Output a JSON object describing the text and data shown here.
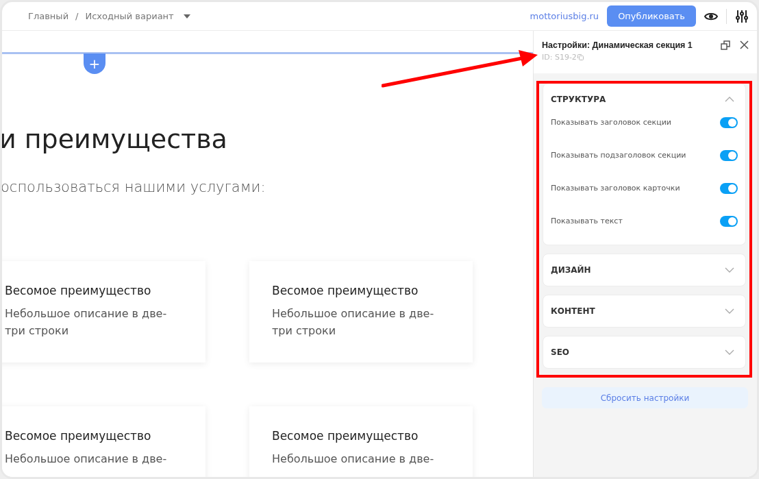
{
  "topbar": {
    "breadcrumbs": [
      {
        "label": "Главный"
      },
      {
        "label": "/"
      },
      {
        "label": "Исходный вариант"
      }
    ],
    "site_link": "mottoriusbig.ru",
    "publish_button": "Опубликовать"
  },
  "canvas": {
    "add_button": "+",
    "heading": "и преимущества",
    "subheading": "оспользоваться нашими услугами:",
    "cards": [
      {
        "title": "Весомое преимущество",
        "description": "Небольшое описание в две-\nтри строки"
      },
      {
        "title": "Весомое преимущество",
        "description": "Небольшое описание в две-\nтри строки"
      },
      {
        "title": "Весомое преимущество",
        "description": "Небольшое описание в две-"
      },
      {
        "title": "Весомое преимущество",
        "description": "Небольшое описание в две-"
      }
    ]
  },
  "panel": {
    "title": "Настройки: Динамическая секция 1",
    "id": "ID: S19-2",
    "sections": [
      {
        "title": "СТРУКТУРА",
        "expanded": true,
        "toggles": [
          {
            "label": "Показывать заголовок секции",
            "on": true
          },
          {
            "label": "Показывать подзаголовок секции",
            "on": true
          },
          {
            "label": "Показывать заголовок карточки",
            "on": true
          },
          {
            "label": "Показывать текст",
            "on": true
          }
        ]
      },
      {
        "title": "ДИЗАЙН",
        "expanded": false
      },
      {
        "title": "КОНТЕНТ",
        "expanded": false
      },
      {
        "title": "SEO",
        "expanded": false
      }
    ],
    "reset_button": "Сбросить настройки"
  }
}
